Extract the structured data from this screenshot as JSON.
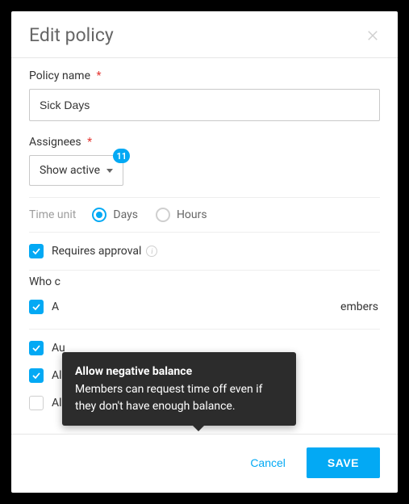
{
  "header": {
    "title": "Edit policy"
  },
  "fields": {
    "policy_name": {
      "label": "Policy name",
      "value": "Sick Days"
    },
    "assignees": {
      "label": "Assignees",
      "dropdown_label": "Show active",
      "badge": "11"
    },
    "time_unit": {
      "label": "Time unit",
      "option_days": "Days",
      "option_hours": "Hours",
      "selected": "Days"
    }
  },
  "checks": {
    "requires_approval": "Requires approval",
    "admins_label_prefix": "A",
    "admins_label_suffix": "embers",
    "auto_label": "Au",
    "allow_negative": "Allow negative balance",
    "allow_half_day": "Allow half day"
  },
  "section": {
    "who_label": "Who c"
  },
  "tooltip": {
    "title": "Allow negative balance",
    "body": "Members can request time off even if they don't have enough balance."
  },
  "footer": {
    "cancel": "Cancel",
    "save": "SAVE"
  }
}
